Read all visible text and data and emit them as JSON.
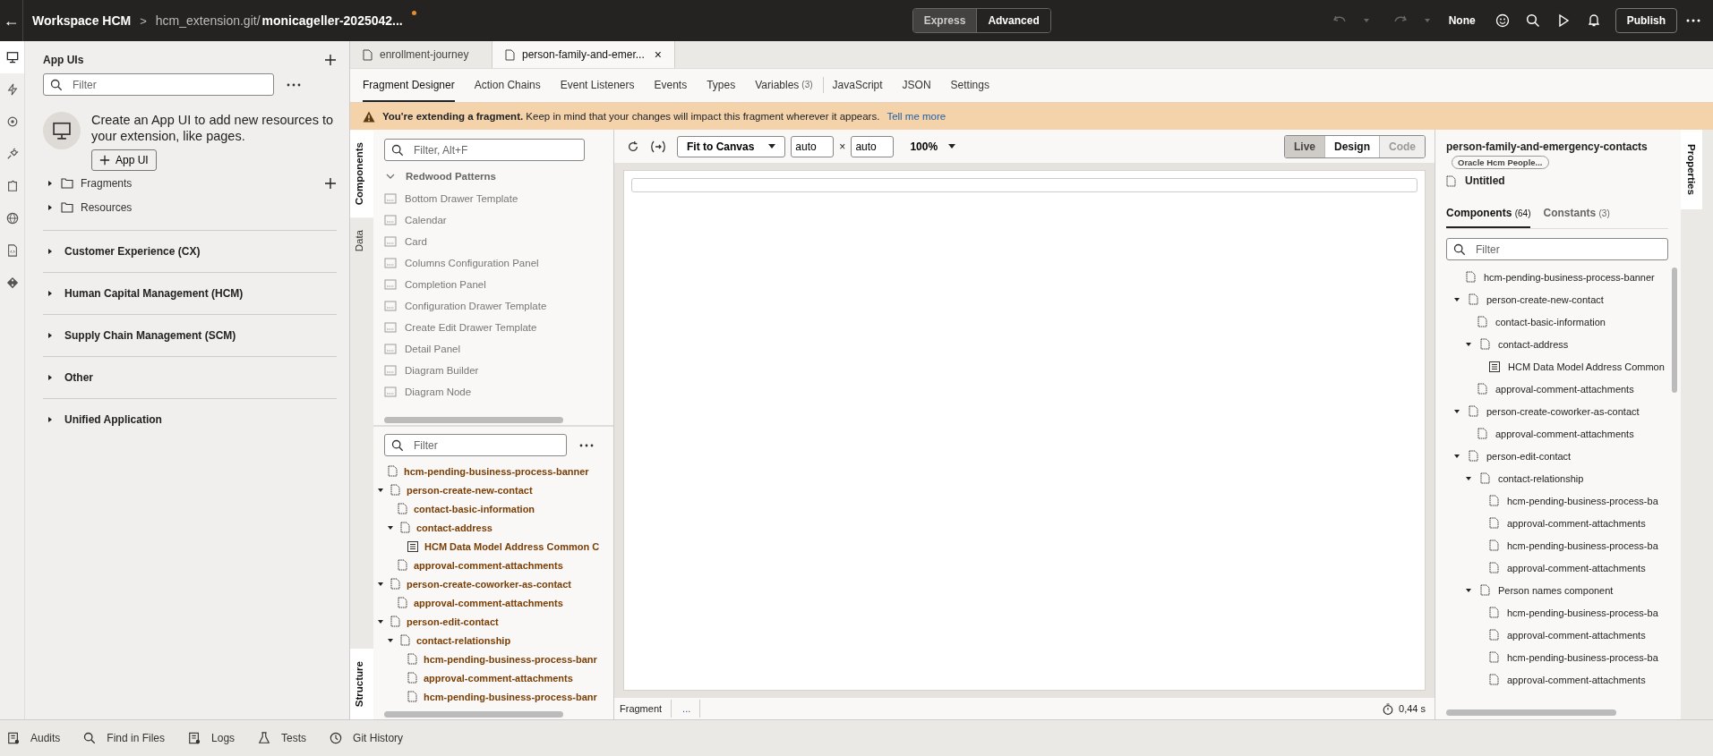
{
  "header": {
    "back": "←",
    "title": "Workspace HCM",
    "separator": ">",
    "repo": "hcm_extension.git/",
    "branch": "monicageller-2025042...",
    "unsaved": true,
    "modes": [
      {
        "label": "Express",
        "selected": true
      },
      {
        "label": "Advanced",
        "selected": false
      }
    ],
    "undo_disabled": true,
    "redo_disabled": true,
    "profile": "None",
    "publish": "Publish"
  },
  "rail": {
    "items": [
      {
        "selected": true
      },
      {
        "selected": false
      },
      {
        "selected": false
      },
      {
        "selected": false
      },
      {
        "selected": false
      },
      {
        "selected": false
      },
      {
        "selected": false
      },
      {
        "selected": false
      }
    ]
  },
  "app_uis": {
    "title": "App UIs",
    "filter_placeholder": "Filter",
    "empty_text": "Create an App UI to add new resources to your extension, like pages.",
    "create_button": "App UI",
    "folders": [
      {
        "label": "Fragments",
        "expanded": false,
        "addable": true
      },
      {
        "label": "Resources",
        "expanded": false,
        "addable": false
      }
    ],
    "sections": [
      {
        "label": "Customer Experience (CX)",
        "expanded": false
      },
      {
        "label": "Human Capital Management (HCM)",
        "expanded": false
      },
      {
        "label": "Supply Chain Management (SCM)",
        "expanded": false
      },
      {
        "label": "Other",
        "expanded": false
      },
      {
        "label": "Unified Application",
        "expanded": false
      }
    ]
  },
  "editor_tabs": [
    {
      "label": "enrollment-journey",
      "selected": false
    },
    {
      "label": "person-family-and-emer...",
      "selected": true,
      "close": "×"
    }
  ],
  "designer_tabs": [
    {
      "label": "Fragment Designer",
      "selected": true
    },
    {
      "label": "Action Chains",
      "selected": false
    },
    {
      "label": "Event Listeners",
      "selected": false
    },
    {
      "label": "Events",
      "selected": false
    },
    {
      "label": "Types",
      "selected": false
    },
    {
      "label": "Variables",
      "count": "(3)",
      "selected": false
    },
    {
      "label": "JavaScript",
      "selected": false,
      "divider": true
    },
    {
      "label": "JSON",
      "selected": false
    },
    {
      "label": "Settings",
      "selected": false
    }
  ],
  "banner": {
    "text": "**You're extending a fragment.** Keep in mind that your changes will impact this fragment wherever it appears.",
    "link": "Tell me more"
  },
  "side_tabs": [
    {
      "label": "Components",
      "selected": true
    },
    {
      "label": "Data",
      "selected": false
    }
  ],
  "structure_tab": {
    "label": "Structure",
    "selected": true
  },
  "palette": {
    "filter_placeholder": "Filter, Alt+F",
    "group": "Redwood Patterns",
    "group_expanded": true,
    "items": [
      "Bottom Drawer Template",
      "Calendar",
      "Card",
      "Columns Configuration Panel",
      "Completion Panel",
      "Configuration Drawer Template",
      "Create Edit Drawer Template",
      "Detail Panel",
      "Diagram Builder",
      "Diagram Node"
    ]
  },
  "structure": {
    "filter_placeholder": "Filter",
    "items": [
      {
        "label": "hcm-pending-business-process-banner",
        "kind": "file"
      },
      {
        "label": "person-create-new-contact",
        "kind": "file",
        "expanded": true,
        "children": [
          {
            "label": "contact-basic-information",
            "kind": "file"
          },
          {
            "label": "contact-address",
            "kind": "file",
            "expanded": true,
            "children": [
              {
                "label": "HCM Data Model Address Common C",
                "kind": "table"
              }
            ]
          },
          {
            "label": "approval-comment-attachments",
            "kind": "file"
          }
        ]
      },
      {
        "label": "person-create-coworker-as-contact",
        "kind": "file",
        "expanded": true,
        "children": [
          {
            "label": "approval-comment-attachments",
            "kind": "file"
          }
        ]
      },
      {
        "label": "person-edit-contact",
        "kind": "file",
        "expanded": true,
        "children": [
          {
            "label": "contact-relationship",
            "kind": "file",
            "expanded": true,
            "children": [
              {
                "label": "hcm-pending-business-process-banr",
                "kind": "file"
              },
              {
                "label": "approval-comment-attachments",
                "kind": "file"
              },
              {
                "label": "hcm-pending-business-process-banr",
                "kind": "file"
              }
            ]
          }
        ]
      }
    ]
  },
  "canvas": {
    "zoom_mode": "Fit to Canvas",
    "width": "auto",
    "times": "×",
    "height": "auto",
    "zoom": "100%",
    "views": [
      {
        "label": "Live",
        "selected": true,
        "disabled": false
      },
      {
        "label": "Design",
        "selected": false,
        "disabled": false
      },
      {
        "label": "Code",
        "selected": false,
        "disabled": true
      }
    ],
    "breadcrumb": [
      "Fragment",
      "..."
    ],
    "timing": "0,44 s"
  },
  "properties": {
    "tab": "Properties",
    "title": "person-family-and-emergency-contacts",
    "badge": "Oracle Hcm People...",
    "name": "Untitled",
    "tabs": [
      {
        "label": "Components",
        "count": "(64)",
        "selected": true
      },
      {
        "label": "Constants",
        "count": "(3)",
        "selected": false
      }
    ],
    "filter_placeholder": "Filter",
    "items": [
      {
        "label": "hcm-pending-business-process-banner",
        "kind": "file"
      },
      {
        "label": "person-create-new-contact",
        "kind": "file",
        "expanded": true,
        "children": [
          {
            "label": "contact-basic-information",
            "kind": "file"
          },
          {
            "label": "contact-address",
            "kind": "file",
            "expanded": true,
            "children": [
              {
                "label": "HCM Data Model Address Common",
                "kind": "table"
              }
            ]
          },
          {
            "label": "approval-comment-attachments",
            "kind": "file"
          }
        ]
      },
      {
        "label": "person-create-coworker-as-contact",
        "kind": "file",
        "expanded": true,
        "children": [
          {
            "label": "approval-comment-attachments",
            "kind": "file"
          }
        ]
      },
      {
        "label": "person-edit-contact",
        "kind": "file",
        "expanded": true,
        "children": [
          {
            "label": "contact-relationship",
            "kind": "file",
            "expanded": true,
            "children": [
              {
                "label": "hcm-pending-business-process-ba",
                "kind": "file"
              },
              {
                "label": "approval-comment-attachments",
                "kind": "file"
              },
              {
                "label": "hcm-pending-business-process-ba",
                "kind": "file"
              },
              {
                "label": "approval-comment-attachments",
                "kind": "file"
              }
            ]
          },
          {
            "label": "Person names component",
            "kind": "file",
            "expanded": true,
            "children": [
              {
                "label": "hcm-pending-business-process-ba",
                "kind": "file"
              },
              {
                "label": "approval-comment-attachments",
                "kind": "file"
              },
              {
                "label": "hcm-pending-business-process-ba",
                "kind": "file"
              },
              {
                "label": "approval-comment-attachments",
                "kind": "file"
              }
            ]
          }
        ]
      }
    ]
  },
  "bottom_bar": [
    "Audits",
    "Find in Files",
    "Logs",
    "Tests",
    "Git History"
  ]
}
